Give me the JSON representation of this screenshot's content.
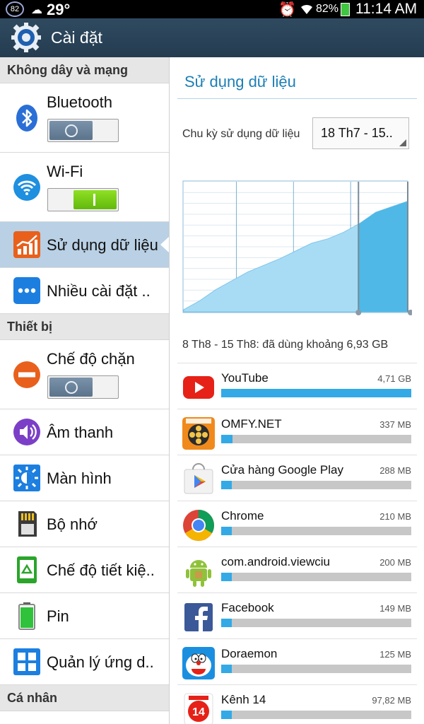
{
  "status_bar": {
    "notification_count": "82",
    "temperature": "29°",
    "battery_percent": "82%",
    "time": "11:14 AM"
  },
  "action_bar": {
    "title": "Cài đặt"
  },
  "left_pane": {
    "sections": [
      {
        "header": "Không dây và mạng",
        "items": [
          {
            "label": "Bluetooth",
            "toggle": "off",
            "icon": "bluetooth-icon"
          },
          {
            "label": "Wi-Fi",
            "toggle": "on",
            "icon": "wifi-icon"
          },
          {
            "label": "Sử dụng dữ liệu",
            "selected": true,
            "icon": "data-usage-icon"
          },
          {
            "label": "Nhiều cài đặt ..",
            "icon": "more-settings-icon"
          }
        ]
      },
      {
        "header": "Thiết bị",
        "items": [
          {
            "label": "Chế độ chặn",
            "toggle": "off",
            "icon": "blocking-mode-icon"
          },
          {
            "label": "Âm thanh",
            "icon": "sound-icon"
          },
          {
            "label": "Màn hình",
            "icon": "display-icon"
          },
          {
            "label": "Bộ nhớ",
            "icon": "storage-icon"
          },
          {
            "label": "Chế độ tiết kiệ..",
            "icon": "power-saving-icon"
          },
          {
            "label": "Pin",
            "icon": "battery-icon"
          },
          {
            "label": "Quản lý ứng d..",
            "icon": "app-manager-icon"
          }
        ]
      },
      {
        "header": "Cá nhân",
        "items": []
      }
    ]
  },
  "right_pane": {
    "title": "Sử dụng dữ liệu",
    "cycle_label": "Chu kỳ sử dụng dữ liệu",
    "cycle_value": "18 Th7 - 15..",
    "range_text": "8 Th8 - 15 Th8: đã dùng khoảng 6,93 GB",
    "usage_curve": [
      0.02,
      0.1,
      0.2,
      0.28,
      0.36,
      0.42,
      0.48,
      0.55,
      0.62,
      0.66,
      0.72,
      0.8,
      0.9,
      0.95,
      1.0
    ],
    "selected_range": [
      0.78,
      1.0
    ],
    "colors": {
      "curve": "#a8dcf5",
      "selected": "#4fb8e6",
      "accent": "#1c7fb5"
    }
  },
  "apps": [
    {
      "name": "YouTube",
      "size": "4,71 GB",
      "usage": 1.0,
      "icon": "youtube-icon"
    },
    {
      "name": "OMFY.NET",
      "size": "337 MB",
      "usage": 0.06,
      "icon": "omfy-icon"
    },
    {
      "name": "Cửa hàng Google Play",
      "size": "288 MB",
      "usage": 0.05,
      "icon": "play-store-icon"
    },
    {
      "name": "Chrome",
      "size": "210 MB",
      "usage": 0.04,
      "icon": "chrome-icon"
    },
    {
      "name": "com.android.viewciu",
      "size": "200 MB",
      "usage": 0.04,
      "icon": "android-icon"
    },
    {
      "name": "Facebook",
      "size": "149 MB",
      "usage": 0.03,
      "icon": "facebook-icon"
    },
    {
      "name": "Doraemon",
      "size": "125 MB",
      "usage": 0.025,
      "icon": "doraemon-icon"
    },
    {
      "name": "Kênh 14",
      "size": "97,82 MB",
      "usage": 0.02,
      "icon": "kenh14-icon"
    }
  ]
}
